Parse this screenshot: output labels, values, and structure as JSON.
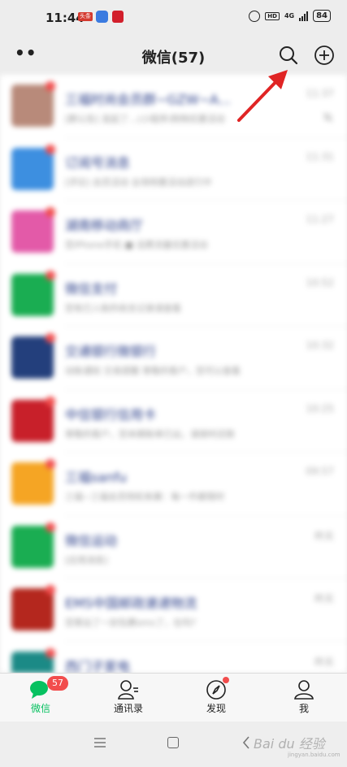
{
  "status_bar": {
    "time": "11:44",
    "app_badge": "头条",
    "network": "4G",
    "hd": "HD",
    "battery": "84"
  },
  "header": {
    "title": "微信(57)",
    "icons": [
      "more-dots-icon",
      "search-icon",
      "add-circle-icon"
    ]
  },
  "chats": [
    {
      "name": "三福时尚会员群~GZW~A...",
      "preview": "[群公告] 发起了…(小程序)购物优惠活动",
      "time": "11:37",
      "muted": true,
      "avatar_color": "#b88a7a"
    },
    {
      "name": "订阅号消息",
      "preview": "[评论] 会员活动 全场特惠活动进行中",
      "time": "11:31",
      "muted": false,
      "avatar_color": "#3d8fe0"
    },
    {
      "name": "湖南移动商厅",
      "preview": "您iPhone手机 ■ 话费流量优惠活动",
      "time": "11:27",
      "muted": false,
      "avatar_color": "#e35aa8"
    },
    {
      "name": "微信支付",
      "preview": "您有已入账的收支记录请查看",
      "time": "10:52",
      "muted": false,
      "avatar_color": "#1aad52"
    },
    {
      "name": "交通银行微银行",
      "preview": "动账通知 交易提醒 尊敬的客户，您可以查看",
      "time": "10:32",
      "muted": false,
      "avatar_color": "#233f7c"
    },
    {
      "name": "中信银行信用卡",
      "preview": "尊敬的客户，您本期账单已出，请按时还款",
      "time": "10:25",
      "muted": false,
      "avatar_color": "#c8202a"
    },
    {
      "name": "三福sanfu",
      "preview": "三福~三福会员特权来袭：每一件都限时",
      "time": "09:57",
      "muted": false,
      "avatar_color": "#f5a524"
    },
    {
      "name": "微信运动",
      "preview": "[应用消息]",
      "time": "昨天",
      "muted": false,
      "avatar_color": "#1aad52"
    },
    {
      "name": "EMS中国邮政速递物流",
      "preview": "您寄出了一封包裹ems了，在吗?",
      "time": "昨天",
      "muted": false,
      "avatar_color": "#b4271e"
    },
    {
      "name": "西门子家电",
      "preview": "",
      "time": "昨天",
      "muted": false,
      "avatar_color": "#1b8a86"
    }
  ],
  "tabs": [
    {
      "label": "微信",
      "badge": "57",
      "active": true
    },
    {
      "label": "通讯录",
      "badge": null,
      "active": false
    },
    {
      "label": "发现",
      "badge": "dot",
      "active": false
    },
    {
      "label": "我",
      "badge": null,
      "active": false
    }
  ],
  "watermark": {
    "text": "Bai du 经验",
    "sub": "jingyan.baidu.com"
  },
  "colors": {
    "accent_green": "#07c160",
    "badge_red": "#f24d4d",
    "arrow_red": "#e02424"
  }
}
